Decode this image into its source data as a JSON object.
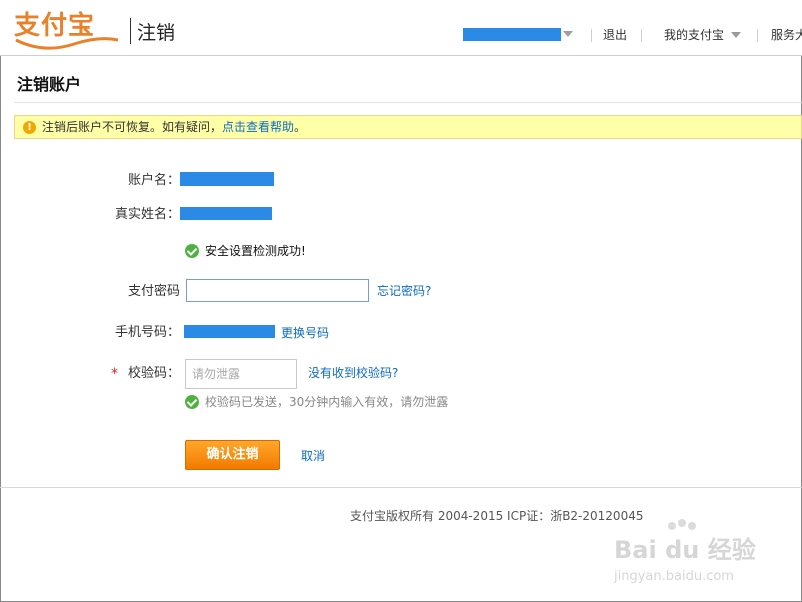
{
  "header": {
    "logo_text": "支付宝",
    "subtitle": "注销",
    "nav": {
      "logout": "退出",
      "my_alipay": "我的支付宝",
      "services": "服务大"
    }
  },
  "page": {
    "title": "注销账户"
  },
  "notice": {
    "text": "注销后账户不可恢复。如有疑问，",
    "link": "点击查看帮助",
    "suffix": "。"
  },
  "form": {
    "account_label": "账户名：",
    "realname_label": "真实姓名：",
    "security_check": "安全设置检测成功!",
    "password_label": "支付密码",
    "forgot_password": "忘记密码?",
    "phone_label": "手机号码：",
    "change_phone": "更换号码",
    "required_mark": "*",
    "code_label": "校验码：",
    "code_placeholder": "请勿泄露",
    "no_code_link": "没有收到校验码?",
    "code_sent_msg": "校验码已发送，30分钟内输入有效，请勿泄露",
    "confirm_button": "确认注销",
    "cancel_link": "取消"
  },
  "footer": {
    "copyright": "支付宝版权所有 2004-2015 ICP证：浙B2-20120045"
  },
  "watermark": {
    "brand": "Bai du 经验",
    "url": "jingyan.baidu.com"
  },
  "colors": {
    "accent_orange": "#f27a00",
    "link_blue": "#0c6bbf",
    "redaction_blue": "#2b8ae6",
    "notice_bg": "#ffffa8",
    "success_green": "#4fb23f"
  }
}
